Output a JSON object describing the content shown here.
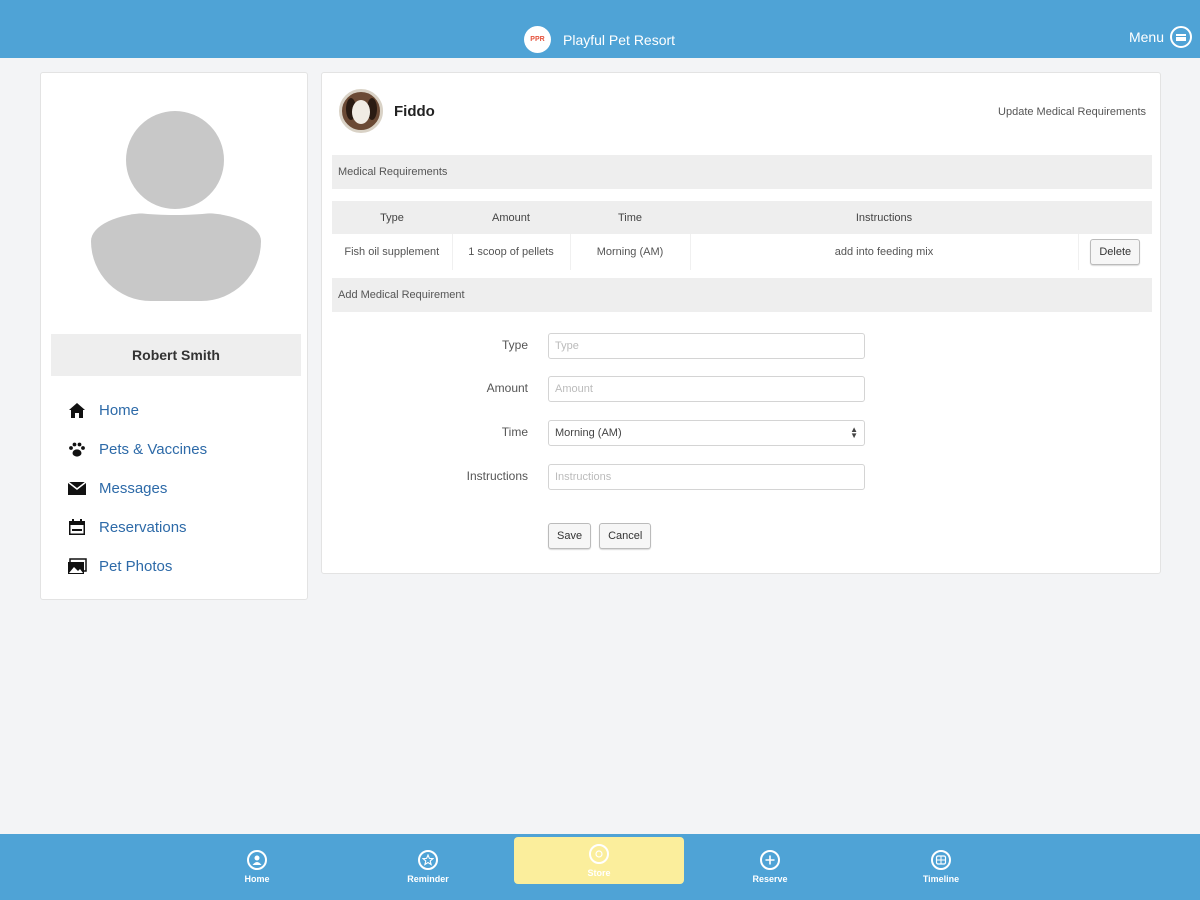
{
  "header": {
    "logo_text": "PPR",
    "title": "Playful Pet Resort",
    "menu_label": "Menu"
  },
  "sidebar": {
    "user_name": "Robert Smith",
    "items": [
      {
        "label": "Home",
        "icon": "home-icon"
      },
      {
        "label": "Pets & Vaccines",
        "icon": "paw-icon"
      },
      {
        "label": "Messages",
        "icon": "envelope-icon"
      },
      {
        "label": "Reservations",
        "icon": "calendar-icon"
      },
      {
        "label": "Pet Photos",
        "icon": "photos-icon"
      }
    ]
  },
  "main": {
    "pet_name": "Fiddo",
    "update_link": "Update Medical Requirements",
    "medical_section_title": "Medical Requirements",
    "table": {
      "headers": [
        "Type",
        "Amount",
        "Time",
        "Instructions",
        ""
      ],
      "rows": [
        {
          "type": "Fish oil supplement",
          "amount": "1 scoop of pellets",
          "time": "Morning (AM)",
          "instructions": "add into feeding mix",
          "action": "Delete"
        }
      ]
    },
    "add_section_title": "Add Medical Requirement",
    "form": {
      "type_label": "Type",
      "type_placeholder": "Type",
      "amount_label": "Amount",
      "amount_placeholder": "Amount",
      "time_label": "Time",
      "time_value": "Morning (AM)",
      "instructions_label": "Instructions",
      "instructions_placeholder": "Instructions",
      "save_label": "Save",
      "cancel_label": "Cancel"
    }
  },
  "bottom_nav": {
    "tabs": [
      {
        "label": "Home",
        "icon": "person-icon"
      },
      {
        "label": "Reminder",
        "icon": "star-icon"
      },
      {
        "label": "Store",
        "icon": "store-icon",
        "active": true
      },
      {
        "label": "Reserve",
        "icon": "plus-icon"
      },
      {
        "label": "Timeline",
        "icon": "timeline-icon"
      }
    ]
  },
  "colors": {
    "primary": "#4fa3d6",
    "active_tab": "#fbee9c",
    "link": "#2d6aa8"
  }
}
